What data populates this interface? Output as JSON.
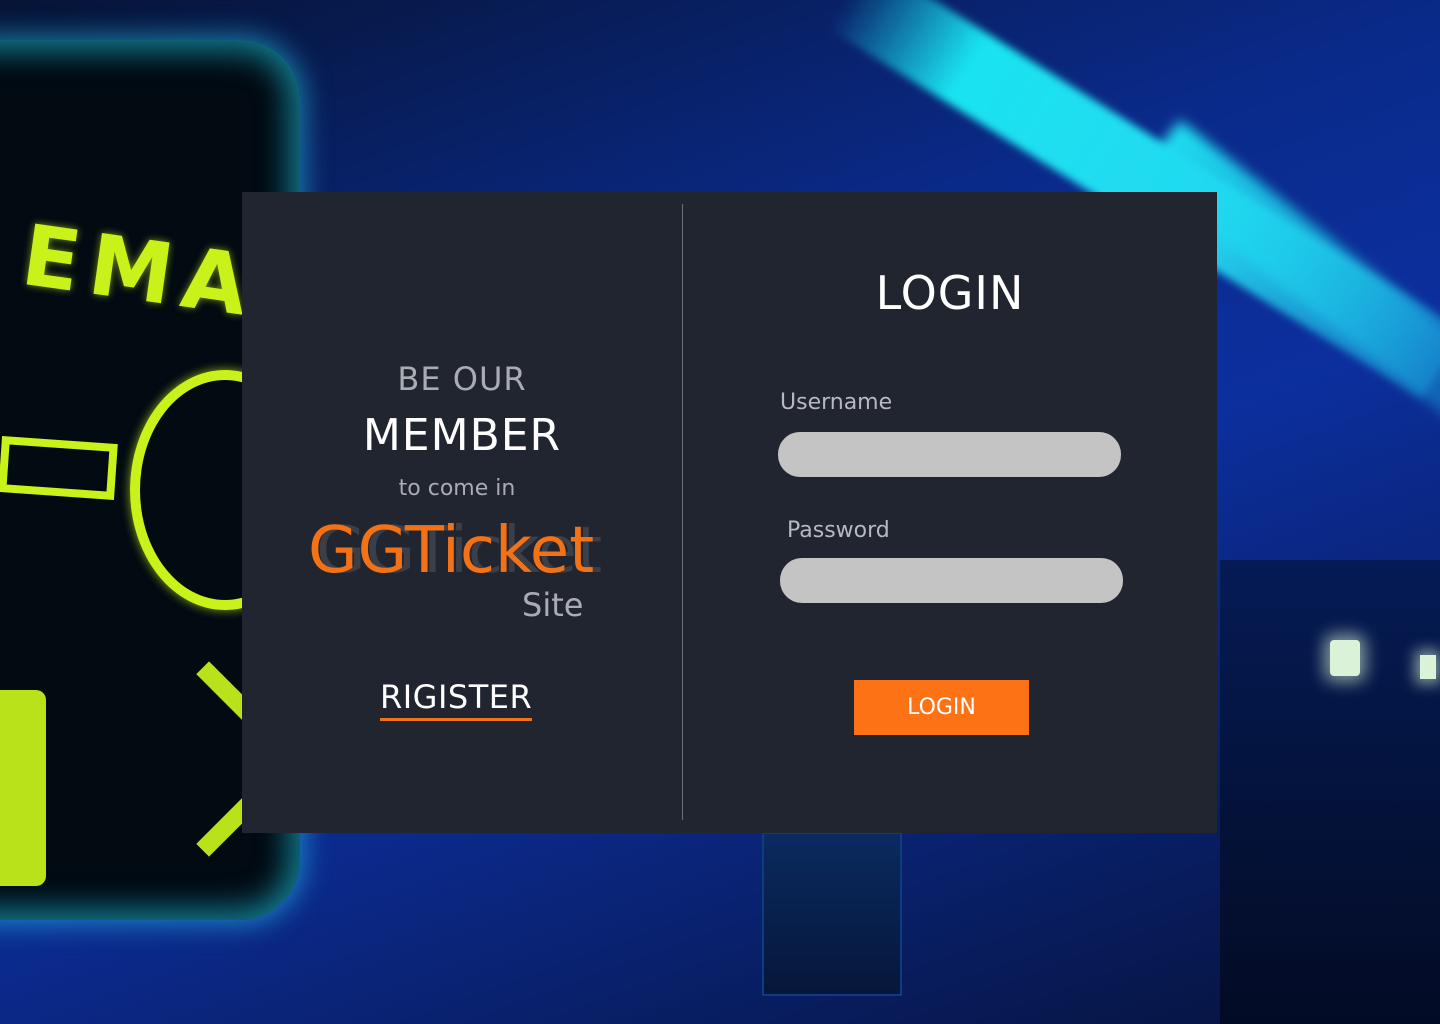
{
  "colors": {
    "accent": "#fc7214",
    "brand": "#f47216",
    "card_bg": "#21252f",
    "input_bg": "#c4c4c4",
    "text_primary": "#ffffff",
    "text_muted": "#a9acb3"
  },
  "promo": {
    "line1": "BE OUR",
    "line2": "MEMBER",
    "line3": "to come in",
    "brand": "GGTicket",
    "brand_suffix": "Site",
    "register_label": "RIGISTER"
  },
  "login_form": {
    "title": "LOGIN",
    "username_label": "Username",
    "username_value": "",
    "password_label": "Password",
    "password_value": "",
    "submit_label": "LOGIN"
  }
}
